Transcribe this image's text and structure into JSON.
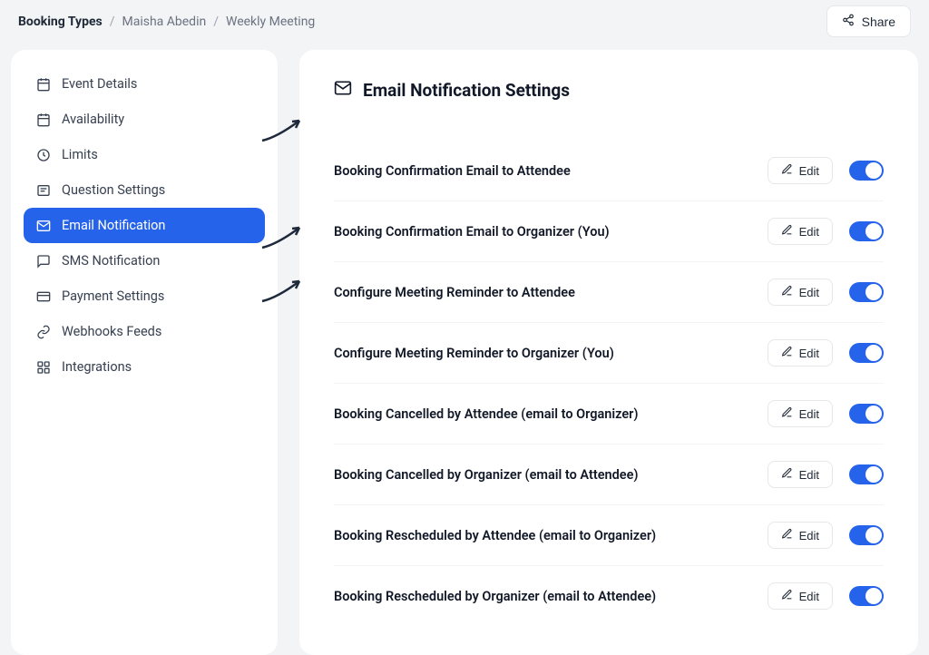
{
  "breadcrumb": {
    "root": "Booking Types",
    "user": "Maisha Abedin",
    "page": "Weekly Meeting"
  },
  "share_label": "Share",
  "sidebar": {
    "items": [
      {
        "label": "Event Details",
        "icon": "calendar-icon"
      },
      {
        "label": "Availability",
        "icon": "calendar-icon"
      },
      {
        "label": "Limits",
        "icon": "clock-icon"
      },
      {
        "label": "Question Settings",
        "icon": "question-icon"
      },
      {
        "label": "Email Notification",
        "icon": "mail-icon"
      },
      {
        "label": "SMS Notification",
        "icon": "sms-icon"
      },
      {
        "label": "Payment Settings",
        "icon": "payment-icon"
      },
      {
        "label": "Webhooks Feeds",
        "icon": "link-icon"
      },
      {
        "label": "Integrations",
        "icon": "integrations-icon"
      }
    ],
    "active_index": 4
  },
  "main": {
    "title": "Email Notification Settings",
    "edit_label": "Edit",
    "settings": [
      {
        "label": "Booking Confirmation Email to Attendee",
        "enabled": true
      },
      {
        "label": "Booking Confirmation Email to Organizer (You)",
        "enabled": true
      },
      {
        "label": "Configure Meeting Reminder to Attendee",
        "enabled": true
      },
      {
        "label": "Configure Meeting Reminder to Organizer (You)",
        "enabled": true
      },
      {
        "label": "Booking Cancelled by Attendee (email to Organizer)",
        "enabled": true
      },
      {
        "label": "Booking Cancelled by Organizer (email to Attendee)",
        "enabled": true
      },
      {
        "label": "Booking Rescheduled by Attendee (email to Organizer)",
        "enabled": true
      },
      {
        "label": "Booking Rescheduled by Organizer (email to Attendee)",
        "enabled": true
      }
    ]
  },
  "annotations": {
    "arrows_to_settings": [
      0,
      2,
      3
    ]
  },
  "colors": {
    "primary": "#2563eb",
    "bg": "#f3f4f6",
    "border": "#e5e7eb",
    "text": "#1f2937"
  }
}
